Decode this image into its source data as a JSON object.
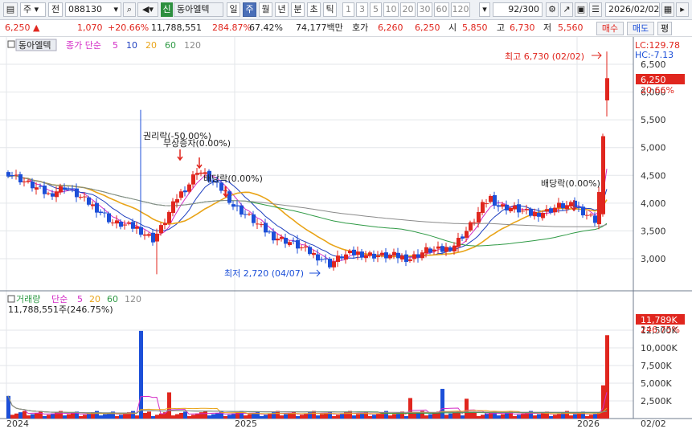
{
  "toolbar": {
    "stock_type": "주",
    "prev_label": "전",
    "stock_code": "088130",
    "sin_badge": "신",
    "stock_name": "동아엘텍",
    "periods": [
      "일",
      "주",
      "월",
      "년",
      "분",
      "초",
      "틱"
    ],
    "selected_period": "주",
    "minute_opts": [
      "1",
      "3",
      "5",
      "10",
      "20",
      "30",
      "60",
      "120"
    ],
    "count": "92",
    "count_total": "/300",
    "date": "2026/02/02"
  },
  "quote": {
    "price": "6,250",
    "change": "1,070",
    "change_pct": "+20.66%",
    "volume": "11,788,551",
    "volume_ratio": "284.87%",
    "turnover_rate": "67.42%",
    "trade_value": "74,177백만",
    "ask_label": "호가",
    "ask": "6,260",
    "bid": "6,250",
    "open_label": "시",
    "open": "5,850",
    "high_label": "고",
    "high": "6,730",
    "low_label": "저",
    "low": "5,560",
    "buy_label": "매수",
    "sell_label": "매도",
    "eval_label": "평"
  },
  "price_panel": {
    "title": "동아엘텍",
    "ma_label": "종가 단순",
    "ma_periods": [
      "5",
      "10",
      "20",
      "60",
      "120"
    ],
    "lc": "LC:129.78",
    "hc": "HC:-7.13",
    "y_ticks": [
      "6,500",
      "6,000",
      "5,500",
      "5,000",
      "4,500",
      "4,000",
      "3,500",
      "3,000"
    ],
    "price_tag": "6,250",
    "pct_tag": "20.66%",
    "high_note": "최고 6,730 (02/02)",
    "low_note": "최저 2,720 (04/07)",
    "events": [
      "권리락(-50.00%)",
      "무상증자(0.00%)",
      "배당락(0.00%)",
      "배당락(0.00%)"
    ]
  },
  "volume_panel": {
    "title": "거래량",
    "ma_label": "단순",
    "ma_periods": [
      "5",
      "20",
      "60",
      "120"
    ],
    "info": "11,788,551주(246.75%)",
    "y_ticks": [
      "12,500K",
      "10,000K",
      "7,500K",
      "5,000K",
      "2,500K"
    ],
    "tag_vol": "11,789K",
    "tag_pct": "246.75%"
  },
  "x_axis": {
    "labels": [
      "2024",
      "2025",
      "2026"
    ],
    "end_label": "02/02"
  },
  "colors": {
    "up": "#e0261e",
    "down": "#1c4fd8",
    "ma5": "#d32cc6",
    "ma10": "#1f3fbf",
    "ma20": "#e9a418",
    "ma60": "#2f9a45",
    "ma120": "#8b8b8b"
  },
  "chart_data": {
    "type": "candlestick",
    "series": [
      {
        "name": "동아엘텍",
        "x_range": [
          "2024",
          "2026/02/02"
        ],
        "ohlc_last": {
          "open": 5850,
          "high": 6730,
          "low": 5560,
          "close": 6250
        }
      },
      {
        "name": "거래량",
        "last": 11788551
      }
    ],
    "high": {
      "value": 6730,
      "date": "02/02"
    },
    "low": {
      "value": 2720,
      "date": "04/07"
    },
    "ylim_price": [
      2700,
      6800
    ]
  }
}
